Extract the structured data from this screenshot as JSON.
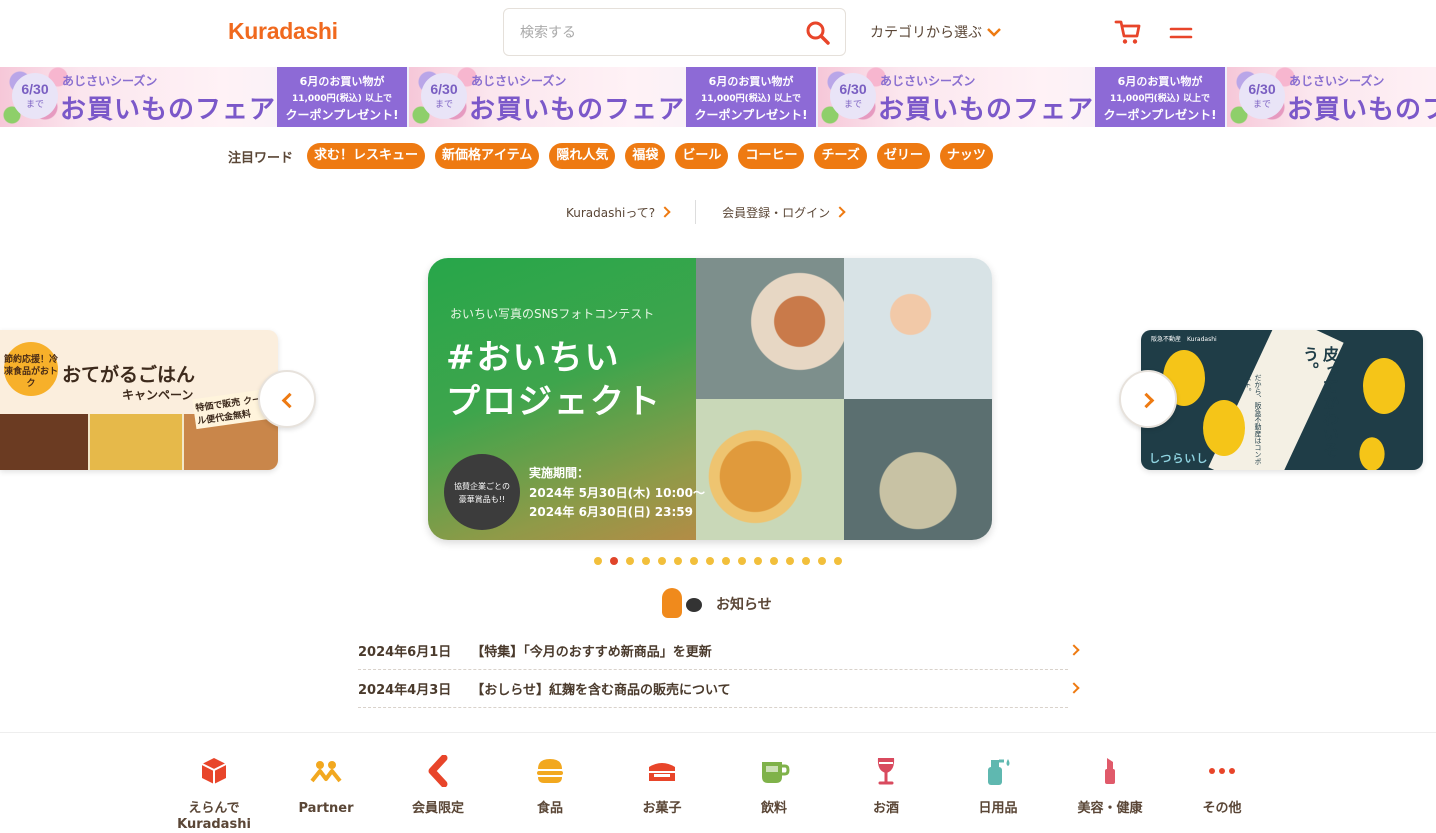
{
  "header": {
    "logo": "Kuradashi",
    "search_placeholder": "検索する",
    "category_label": "カテゴリから選ぶ",
    "accent_color": "#ee7a12"
  },
  "banner": {
    "date": "6/30",
    "date_suffix": "まで",
    "season": "あじさいシーズン",
    "fair": "お買いものフェア",
    "coupon_line1": "6月のお買い物が",
    "coupon_line2": "11,000円(税込) 以上で",
    "coupon_line3": "クーポンプレゼント!"
  },
  "keywords": {
    "label": "注目ワード",
    "items": [
      "求む！レスキュー",
      "新価格アイテム",
      "隠れ人気",
      "福袋",
      "ビール",
      "コーヒー",
      "チーズ",
      "ゼリー",
      "ナッツ"
    ]
  },
  "links": {
    "about": "Kuradashiって?",
    "login": "会員登録・ログイン"
  },
  "carousel": {
    "main": {
      "subtitle": "おいちい写真のSNSフォトコンテスト",
      "title_line1": "#おいちい",
      "title_line2": "プロジェクト",
      "badge_line1": "協賛企業ごとの",
      "badge_line2": "豪華賞品も!!",
      "period_label": "実施期間：",
      "period_start": "2024年 5月30日(木) 10:00〜",
      "period_end": "2024年 6月30日(日) 23:59"
    },
    "left": {
      "badge": "節約応援！冷凍食品がおトク",
      "title": "おてがるごはん",
      "subtitle": "キャンペーン",
      "note": "特価で販売 クール便代金無料"
    },
    "right": {
      "header": "阪急不動産　Kuradashi",
      "text1": "皮ってかわいそう。",
      "text2": "だから、阪急不動産はコンポスト。",
      "logo": "しつらいし"
    },
    "dot_count": 16,
    "active_dot": 1
  },
  "notices": {
    "title": "お知らせ",
    "items": [
      {
        "date": "2024年6月1日",
        "text": "【特集】「今月のおすすめ新商品」を更新"
      },
      {
        "date": "2024年4月3日",
        "text": "【おしらせ】紅麹を含む商品の販売について"
      }
    ]
  },
  "bottom_nav": [
    {
      "label": "えらんで\nKuradashi",
      "icon": "box-icon",
      "color": "#e8452a"
    },
    {
      "label": "Partner",
      "icon": "people-icon",
      "color": "#f2a81f"
    },
    {
      "label": "会員限定",
      "icon": "k-logo-icon",
      "color": "#e8452a"
    },
    {
      "label": "食品",
      "icon": "burger-icon",
      "color": "#f2a81f"
    },
    {
      "label": "お菓子",
      "icon": "cake-icon",
      "color": "#e8452a"
    },
    {
      "label": "飲料",
      "icon": "cup-icon",
      "color": "#7fb24a"
    },
    {
      "label": "お酒",
      "icon": "wine-icon",
      "color": "#d94a5e"
    },
    {
      "label": "日用品",
      "icon": "spray-icon",
      "color": "#5fb8b0"
    },
    {
      "label": "美容・健康",
      "icon": "lipstick-icon",
      "color": "#e05a6a"
    },
    {
      "label": "その他",
      "icon": "more-icon",
      "color": "#e8452a"
    }
  ]
}
